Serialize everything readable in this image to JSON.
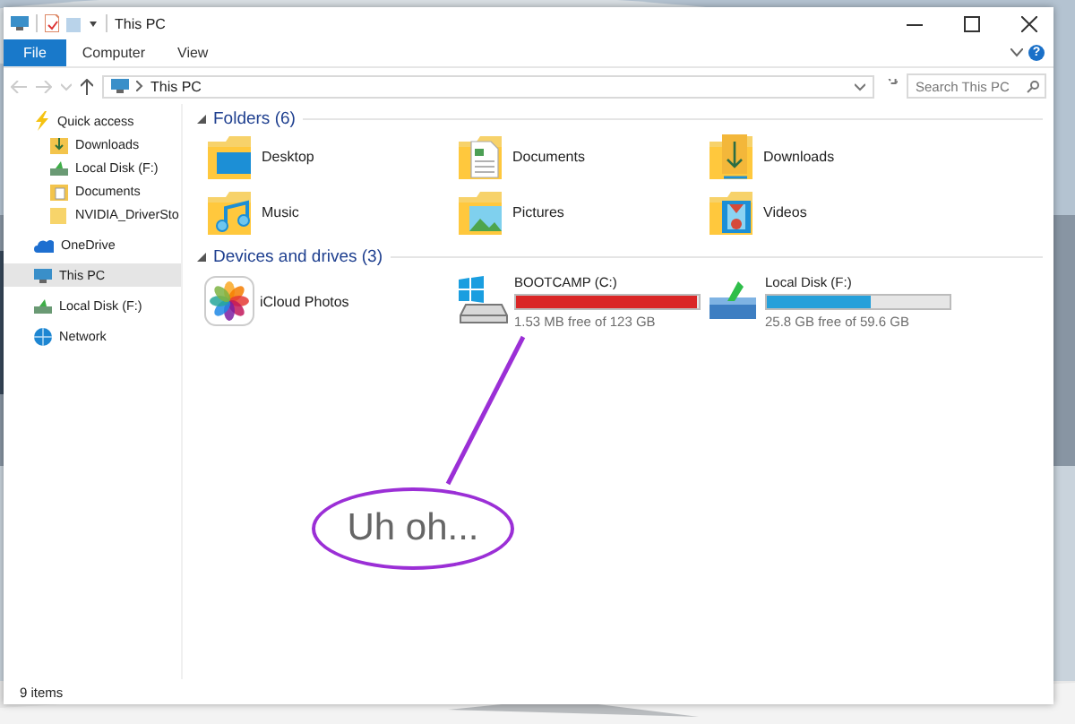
{
  "window": {
    "title": "This PC",
    "help": "?"
  },
  "ribbon": {
    "tabs": [
      {
        "label": "File",
        "kind": "file"
      },
      {
        "label": "Computer",
        "kind": "tab"
      },
      {
        "label": "View",
        "kind": "tab"
      }
    ]
  },
  "address": {
    "path": "This PC"
  },
  "search": {
    "placeholder": "Search This PC"
  },
  "sidebar": {
    "items": [
      {
        "label": "Quick access",
        "kind": "star",
        "selected": false,
        "children": [
          {
            "label": "Downloads",
            "kind": "download",
            "selected": false
          },
          {
            "label": "Local Disk (F:)",
            "kind": "drive",
            "selected": false
          },
          {
            "label": "Documents",
            "kind": "document",
            "selected": false
          },
          {
            "label": "NVIDIA_DriverSto",
            "kind": "folder",
            "selected": false
          }
        ]
      },
      {
        "label": "OneDrive",
        "kind": "cloud",
        "selected": false
      },
      {
        "label": "This PC",
        "kind": "pc",
        "selected": true
      },
      {
        "label": "Local Disk (F:)",
        "kind": "drive",
        "selected": false
      },
      {
        "label": "Network",
        "kind": "network",
        "selected": false
      }
    ]
  },
  "folders": {
    "title": "Folders (6)",
    "expanded": true,
    "items": [
      {
        "label": "Desktop",
        "kind": "desktop"
      },
      {
        "label": "Documents",
        "kind": "documents"
      },
      {
        "label": "Downloads",
        "kind": "downloads"
      },
      {
        "label": "Music",
        "kind": "music"
      },
      {
        "label": "Pictures",
        "kind": "pictures"
      },
      {
        "label": "Videos",
        "kind": "videos"
      }
    ]
  },
  "devices": {
    "title": "Devices and drives (3)",
    "expanded": true,
    "items": [
      {
        "label": "iCloud Photos",
        "kind": "app"
      },
      {
        "label": "BOOTCAMP (C:)",
        "kind": "system-drive",
        "level": 0.99,
        "color": "#da2626",
        "free": "1.53 MB free of 123 GB"
      },
      {
        "label": "Local Disk (F:)",
        "kind": "drive",
        "level": 0.57,
        "color": "#26a0da",
        "free": "25.8 GB free of 59.6 GB"
      }
    ]
  },
  "status_bar": {
    "text": "9 items"
  },
  "annotation": {
    "text": "Uh oh..."
  }
}
